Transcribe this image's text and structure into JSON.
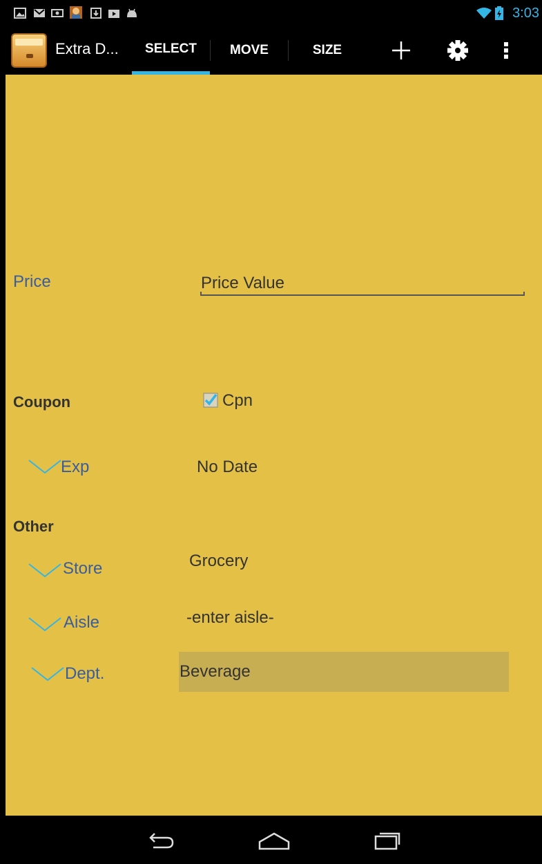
{
  "status_bar": {
    "time": "3:03",
    "icons": [
      "gallery-icon",
      "gmail-icon",
      "email-icon",
      "game-icon",
      "download-icon",
      "play-store-icon",
      "android-icon"
    ],
    "right_icons": [
      "wifi-icon",
      "battery-icon"
    ]
  },
  "action_bar": {
    "app_title": "Extra D...",
    "tabs": [
      {
        "label": "SELECT",
        "selected": true
      },
      {
        "label": "MOVE",
        "selected": false
      },
      {
        "label": "SIZE",
        "selected": false
      }
    ],
    "actions": [
      "add-icon",
      "settings-icon",
      "overflow-menu-icon"
    ]
  },
  "form": {
    "price_label": "Price",
    "price_value": "Price Value",
    "coupon_label": "Coupon",
    "coupon_checkbox_label": "Cpn",
    "coupon_checked": true,
    "exp_label": "Exp",
    "exp_value": "No Date",
    "other_label": "Other",
    "store_label": "Store",
    "store_value": "Grocery",
    "aisle_label": "Aisle",
    "aisle_value": "-enter aisle-",
    "dept_label": "Dept.",
    "dept_value": "Beverage"
  },
  "colors": {
    "background": "#e4c046",
    "accent": "#33b5e5",
    "label_blue": "#3b5d9b",
    "highlight": "#c8ae52"
  },
  "nav_bar": [
    "back-icon",
    "home-icon",
    "recents-icon"
  ]
}
